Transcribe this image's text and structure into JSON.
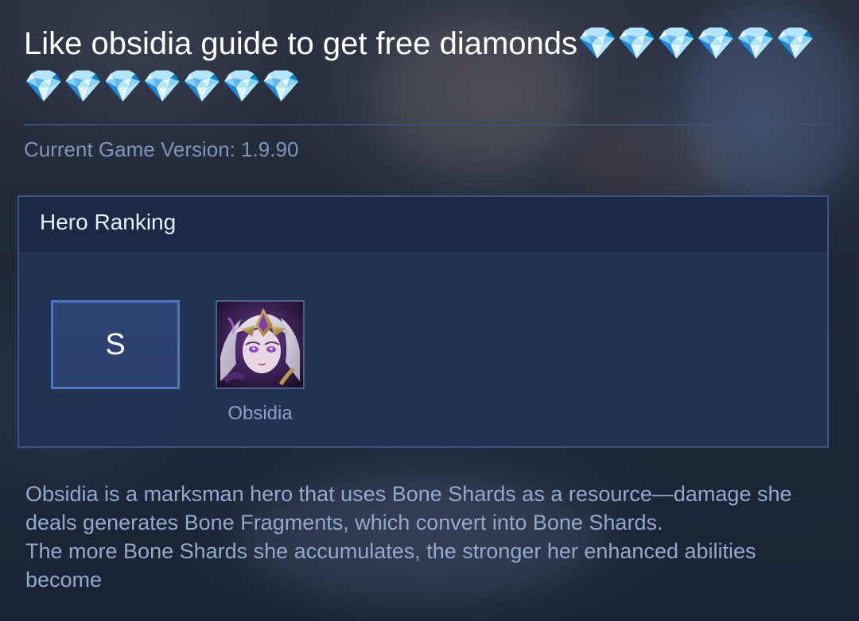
{
  "post": {
    "title": "Like obsidia guide to get free diamonds💎💎💎💎💎💎💎💎💎💎💎💎💎"
  },
  "version": {
    "text": "Current Game Version: 1.9.90"
  },
  "ranking": {
    "title": "Hero Ranking",
    "tier": "S",
    "hero": {
      "name": "Obsidia",
      "portrait_icon": "obsidia-portrait"
    }
  },
  "description": {
    "line1": "Obsidia is a marksman hero that uses Bone Shards as a resource—damage she deals generates Bone Fragments, which convert into Bone Shards.",
    "line2": "The more Bone Shards she accumulates, the stronger her enhanced abilities become"
  },
  "colors": {
    "card_border": "#3d5580",
    "tier_border": "#4d78c0",
    "muted_text": "#7f95b8"
  }
}
